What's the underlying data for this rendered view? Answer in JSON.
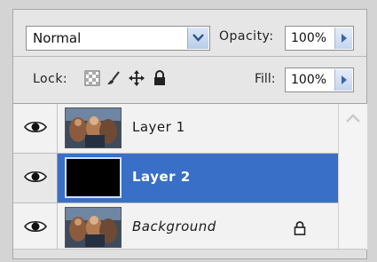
{
  "blend": {
    "mode": "Normal"
  },
  "opacity": {
    "label": "Opacity:",
    "value": "100%"
  },
  "lock": {
    "label": "Lock:"
  },
  "fill": {
    "label": "Fill:",
    "value": "100%"
  },
  "layers": [
    {
      "name": "Layer 1",
      "visible": true,
      "selected": false,
      "thumbnail": "photo"
    },
    {
      "name": "Layer 2",
      "visible": true,
      "selected": true,
      "thumbnail": "black"
    },
    {
      "name": "Background",
      "visible": true,
      "selected": false,
      "thumbnail": "photo",
      "locked": true
    }
  ],
  "colors": {
    "selection": "#3a6fc7",
    "panel": "#e6e6e6",
    "accent_arrow": "#3b63a8"
  }
}
